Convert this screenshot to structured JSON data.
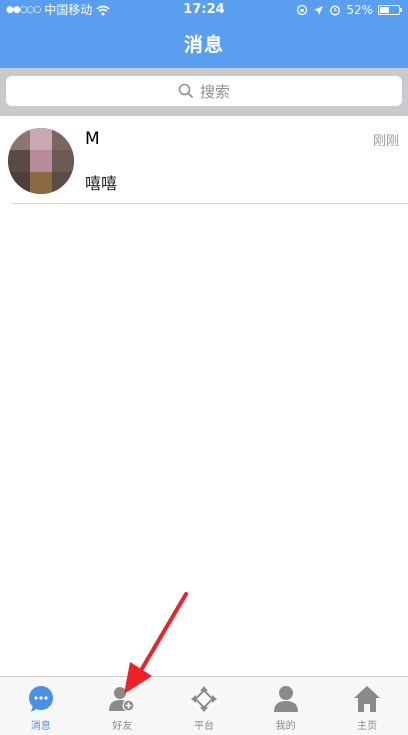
{
  "status_bar": {
    "signal": "●●○○○",
    "carrier": "中国移动",
    "time": "17:24",
    "battery_percent": "52%",
    "battery_level": 0.52
  },
  "header": {
    "title": "消息"
  },
  "search": {
    "placeholder": "搜索"
  },
  "conversations": [
    {
      "name": "M",
      "time": "刚刚",
      "message": "嘻嘻"
    }
  ],
  "tabbar": {
    "items": [
      {
        "label": "消息",
        "icon": "chat-bubble-icon",
        "active": true
      },
      {
        "label": "好友",
        "icon": "add-friend-icon",
        "active": false
      },
      {
        "label": "平台",
        "icon": "platform-icon",
        "active": false
      },
      {
        "label": "我的",
        "icon": "person-icon",
        "active": false
      },
      {
        "label": "主页",
        "icon": "home-icon",
        "active": false
      }
    ]
  },
  "colors": {
    "header": "#5a9ef0",
    "active_tab": "#4a8fe8",
    "inactive_tab": "#8a8a8a",
    "annotation_arrow": "#f0202a"
  }
}
